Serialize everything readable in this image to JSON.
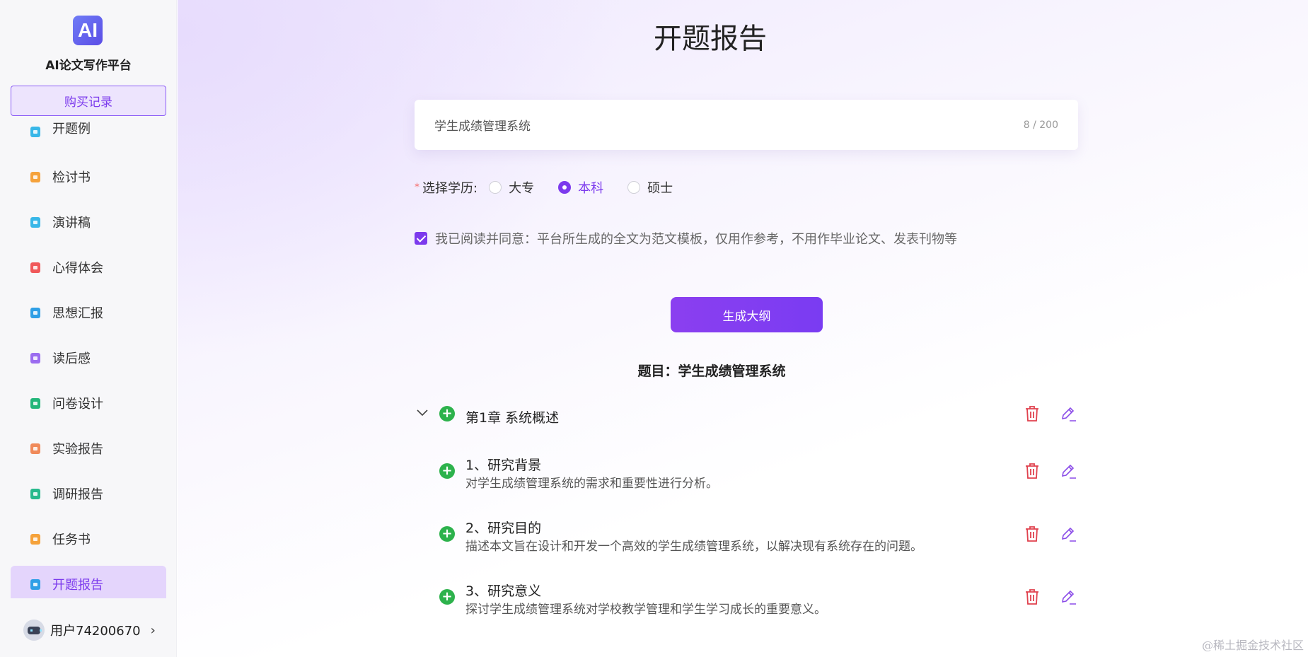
{
  "sidebar": {
    "logo_text": "AI",
    "app_title": "AI论文写作平台",
    "buy_records_label": "购买记录",
    "partial_item_label": "开题例",
    "items": [
      {
        "label": "检讨书",
        "color": "#f5a23b"
      },
      {
        "label": "演讲稿",
        "color": "#38b7e8"
      },
      {
        "label": "心得体会",
        "color": "#f0585a"
      },
      {
        "label": "思想汇报",
        "color": "#2f9fe6"
      },
      {
        "label": "读后感",
        "color": "#9b6cf0"
      },
      {
        "label": "问卷设计",
        "color": "#23b67a"
      },
      {
        "label": "实验报告",
        "color": "#f08a5a"
      },
      {
        "label": "调研报告",
        "color": "#27b98c"
      },
      {
        "label": "任务书",
        "color": "#f5a23b"
      },
      {
        "label": "开题报告",
        "color": "#2f9fe6",
        "active": true
      }
    ],
    "user_name": "用户74200670"
  },
  "main": {
    "page_title": "开题报告",
    "topic_input": {
      "value": "学生成绩管理系统",
      "counter": "8 / 200"
    },
    "education": {
      "label": "选择学历:",
      "options": [
        {
          "label": "大专",
          "checked": false
        },
        {
          "label": "本科",
          "checked": true
        },
        {
          "label": "硕士",
          "checked": false
        }
      ]
    },
    "agreement_text": "我已阅读并同意：平台所生成的全文为范文模板，仅用作参考，不用作毕业论文、发表刊物等",
    "generate_button": "生成大纲",
    "subject_line": "题目：学生成绩管理系统",
    "outline": {
      "chapter_title": "第1章 系统概述",
      "sections": [
        {
          "title": "1、研究背景",
          "desc": "对学生成绩管理系统的需求和重要性进行分析。"
        },
        {
          "title": "2、研究目的",
          "desc": "描述本文旨在设计和开发一个高效的学生成绩管理系统，以解决现有系统存在的问题。"
        },
        {
          "title": "3、研究意义",
          "desc": "探讨学生成绩管理系统对学校教学管理和学生学习成长的重要意义。"
        }
      ]
    }
  },
  "watermark": "@稀土掘金技术社区",
  "colors": {
    "accent": "#7c3aed",
    "add_green": "#2db24c",
    "delete_red": "#e0424e",
    "edit_purple": "#8b4ce8"
  }
}
